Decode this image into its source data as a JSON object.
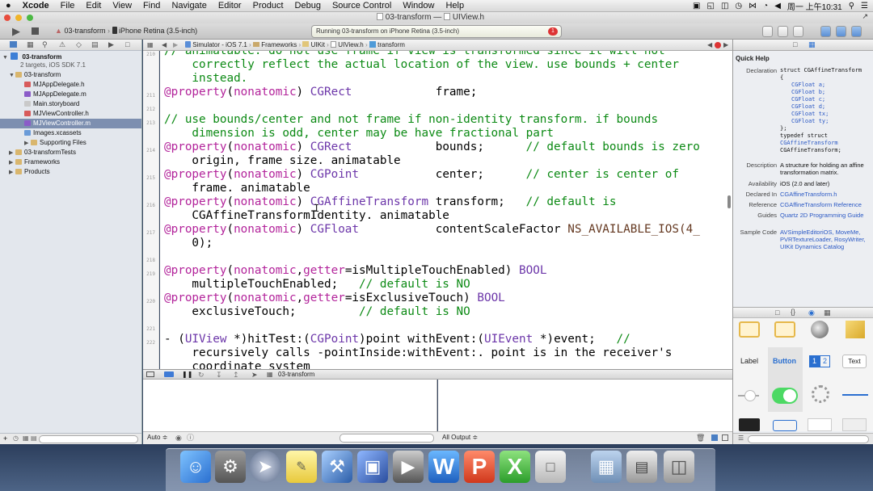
{
  "menubar": {
    "apple": "",
    "items": [
      "Xcode",
      "File",
      "Edit",
      "View",
      "Find",
      "Navigate",
      "Editor",
      "Product",
      "Debug",
      "Source Control",
      "Window",
      "Help"
    ],
    "clock": "周一 上午10:31"
  },
  "window": {
    "title": "03-transform — ",
    "file": "UIView.h"
  },
  "toolbar": {
    "scheme": "03-transform",
    "device": "iPhone Retina (3.5-inch)",
    "activity": "Running 03-transform on iPhone Retina (3.5-inch)",
    "error_count": "1"
  },
  "navigator": {
    "project_name": "03-transform",
    "project_sub": "2 targets, iOS SDK 7.1",
    "items": [
      {
        "label": "03-transform",
        "kind": "group",
        "indent": 1
      },
      {
        "label": "MJAppDelegate.h",
        "kind": "h",
        "indent": 2
      },
      {
        "label": "MJAppDelegate.m",
        "kind": "m",
        "indent": 2
      },
      {
        "label": "Main.storyboard",
        "kind": "sb",
        "indent": 2
      },
      {
        "label": "MJViewController.h",
        "kind": "h",
        "indent": 2
      },
      {
        "label": "MJViewController.m",
        "kind": "m",
        "indent": 2,
        "selected": true
      },
      {
        "label": "Images.xcassets",
        "kind": "assets",
        "indent": 2
      },
      {
        "label": "Supporting Files",
        "kind": "group",
        "indent": 2
      },
      {
        "label": "03-transformTests",
        "kind": "group",
        "indent": 1
      },
      {
        "label": "Frameworks",
        "kind": "group",
        "indent": 1
      },
      {
        "label": "Products",
        "kind": "group",
        "indent": 1
      }
    ]
  },
  "jumpbar": {
    "crumbs": [
      "Simulator - iOS 7.1",
      "Frameworks",
      "UIKit",
      "UIView.h",
      "transform"
    ]
  },
  "editor": {
    "line_numbers": [
      "210",
      "211",
      "212",
      "213",
      "214",
      "215",
      "216",
      "217",
      "218",
      "219",
      "220",
      "221",
      "222"
    ],
    "lines": [
      "// animatable. do not use frame if view is transformed since it will not",
      "    correctly reflect the actual location of the view. use bounds + center",
      "    instead.",
      "@property(nonatomic) CGRect            frame;",
      "",
      "// use bounds/center and not frame if non-identity transform. if bounds",
      "    dimension is odd, center may be have fractional part",
      "@property(nonatomic) CGRect            bounds;      // default bounds is zero",
      "    origin, frame size. animatable",
      "@property(nonatomic) CGPoint           center;      // center is center of",
      "    frame. animatable",
      "@property(nonatomic) CGAffineTransform transform;   // default is",
      "    CGAffineTransformIdentity. animatable",
      "@property(nonatomic) CGFloat           contentScaleFactor NS_AVAILABLE_IOS(4_",
      "    0);",
      "",
      "@property(nonatomic,getter=isMultipleTouchEnabled) BOOL",
      "    multipleTouchEnabled;   // default is NO",
      "@property(nonatomic,getter=isExclusiveTouch) BOOL",
      "    exclusiveTouch;         // default is NO",
      "",
      "- (UIView *)hitTest:(CGPoint)point withEvent:(UIEvent *)event;   //",
      "    recursively calls -pointInside:withEvent:. point is in the receiver's",
      "    coordinate system"
    ]
  },
  "debug": {
    "target": "03-transform",
    "auto_label": "Auto ≑",
    "output_label": "All Output ≑"
  },
  "quick_help": {
    "title": "Quick Help",
    "declaration_label": "Declaration",
    "declaration": [
      "struct CGAffineTransform",
      "{",
      "  CGFloat a;",
      "  CGFloat b;",
      "  CGFloat c;",
      "  CGFloat d;",
      "  CGFloat tx;",
      "  CGFloat ty;",
      "};",
      "typedef struct",
      "CGAffineTransform",
      "CGAffineTransform;"
    ],
    "description_label": "Description",
    "description": "A structure for holding an affine transformation matrix.",
    "availability_label": "Availability",
    "availability": "iOS (2.0 and later)",
    "declared_label": "Declared In",
    "declared": "CGAffineTransform.h",
    "reference_label": "Reference",
    "reference": "CGAffineTransform Reference",
    "guides_label": "Guides",
    "guides": "Quartz 2D Programming Guide",
    "sample_label": "Sample Code",
    "sample": "AVSimpleEditoriOS, MoveMe, PVRTextureLoader, RosyWriter, UIKit Dynamics Catalog"
  },
  "library": {
    "label": "Label",
    "button": "Button",
    "seg1": "1",
    "seg2": "2",
    "text": "Text"
  },
  "colors": {
    "keyword": "#b3249b",
    "type": "#6c36a9",
    "comment": "#0c8a14",
    "macro": "#643820",
    "selection": "#7d8fb0"
  }
}
